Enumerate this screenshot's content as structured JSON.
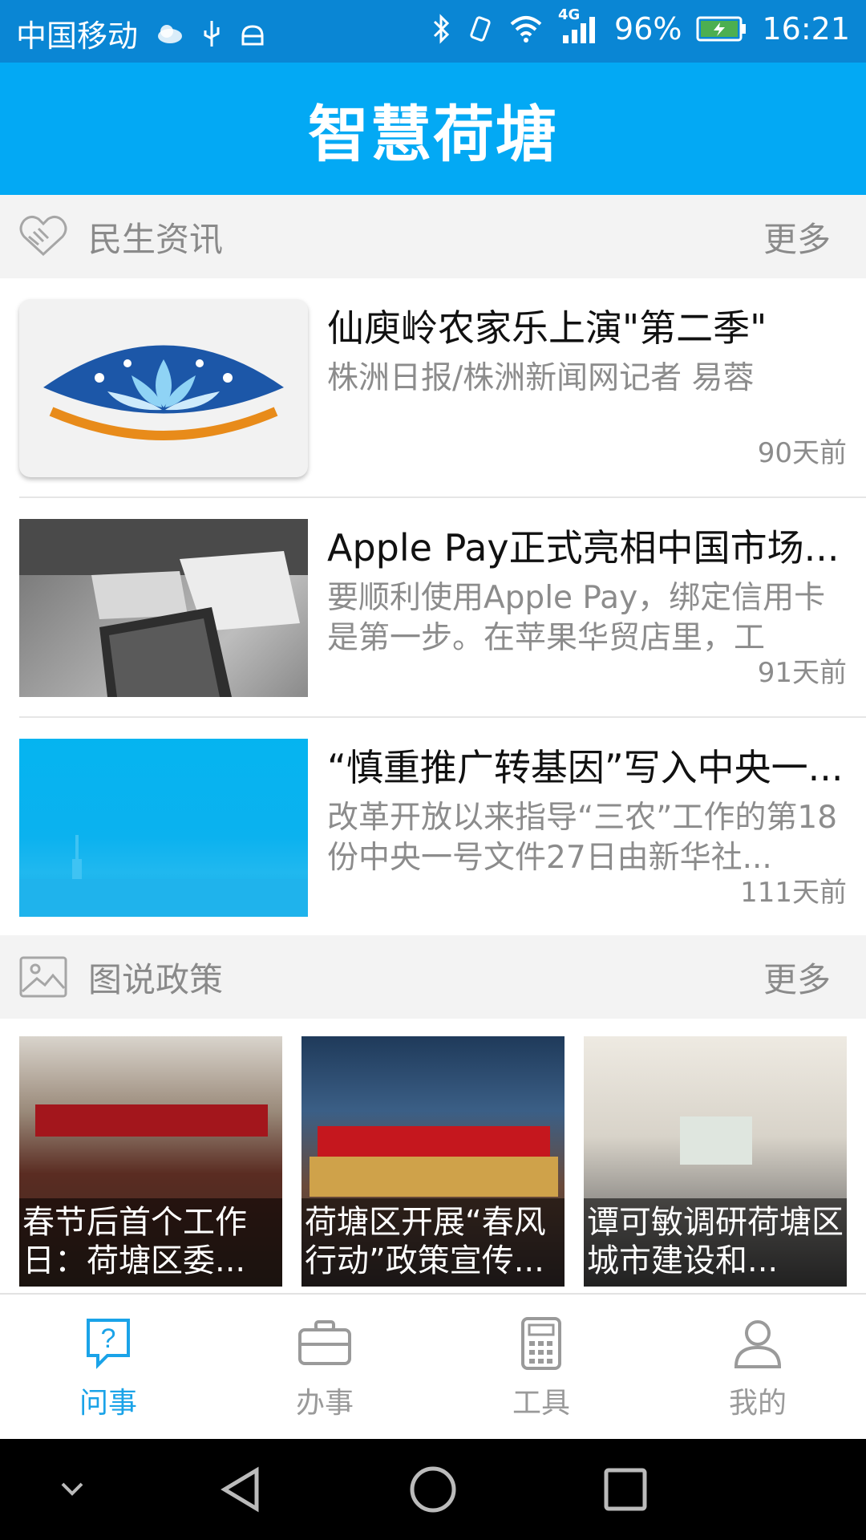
{
  "status_bar": {
    "carrier": "中国移动",
    "network": "4G",
    "battery": "96%",
    "time": "16:21"
  },
  "app": {
    "title": "智慧荷塘"
  },
  "sections": {
    "news": {
      "label": "民生资讯",
      "more": "更多"
    },
    "policy": {
      "label": "图说政策",
      "more": "更多"
    }
  },
  "news_items": [
    {
      "title": "仙庾岭农家乐上演\"第二季\"",
      "desc": "株洲日报/株洲新闻网记者 易蓉",
      "time": "90天前"
    },
    {
      "title": "Apple Pay正式亮相中国市场...",
      "desc": "要顺利使用Apple Pay，绑定信用卡是第一步。在苹果华贸店里，工",
      "time": "91天前"
    },
    {
      "title": "“慎重推广转基因”写入中央一...",
      "desc": "改革开放以来指导“三农”工作的第18份中央一号文件27日由新华社...",
      "time": "111天前"
    }
  ],
  "policy_items": [
    {
      "caption": "春节后首个工作日：荷塘区委..."
    },
    {
      "caption": "荷塘区开展“春风行动”政策宣传..."
    },
    {
      "caption": "谭可敏调研荷塘区城市建设和..."
    }
  ],
  "tabs": [
    {
      "label": "问事",
      "icon": "question-icon",
      "active": true
    },
    {
      "label": "办事",
      "icon": "briefcase-icon",
      "active": false
    },
    {
      "label": "工具",
      "icon": "calculator-icon",
      "active": false
    },
    {
      "label": "我的",
      "icon": "user-icon",
      "active": false
    }
  ],
  "colors": {
    "primary": "#03a9f4",
    "active_tab": "#1aa3e8",
    "section_bg": "#f3f3f3"
  }
}
